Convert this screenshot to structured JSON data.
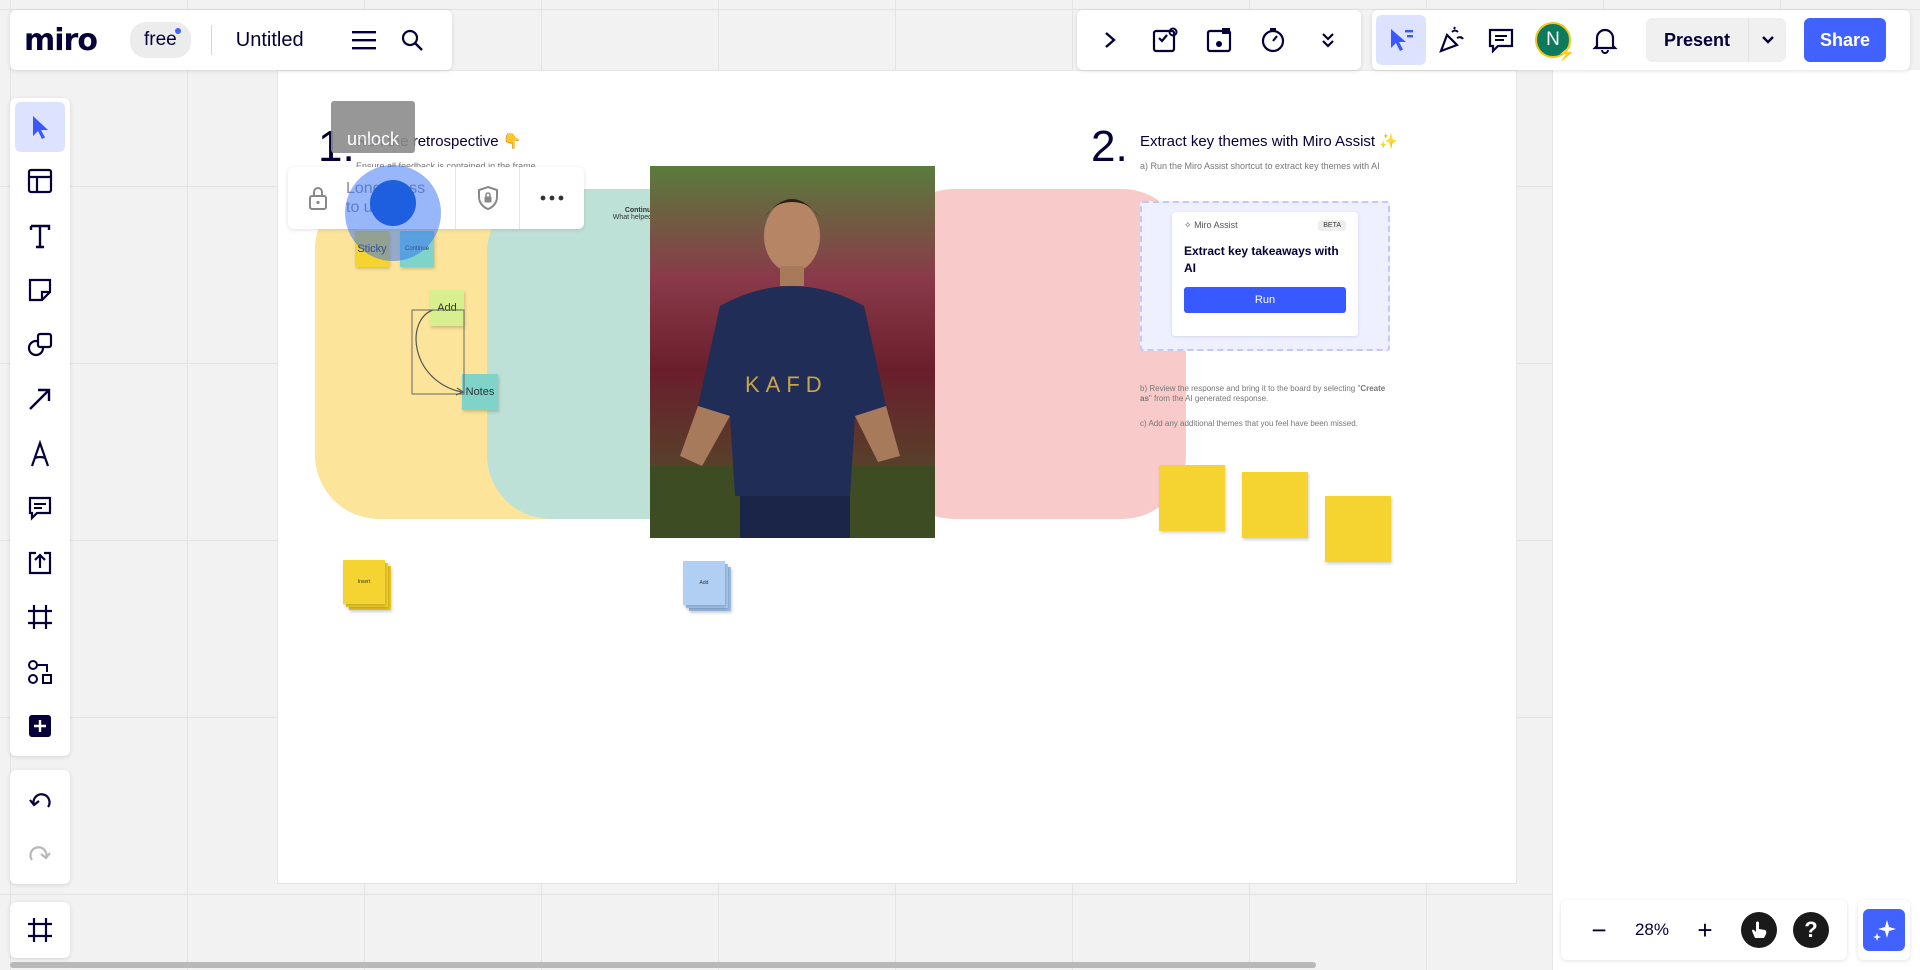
{
  "app": {
    "logo": "miro",
    "plan_badge": "free",
    "board_title": "Untitled"
  },
  "header": {
    "present_label": "Present",
    "share_label": "Share",
    "avatar_initial": "N"
  },
  "zoom": {
    "level": "28%",
    "minus": "−",
    "plus": "+",
    "help": "?"
  },
  "lock_popup": {
    "tooltip": "unlock",
    "hint_line1": "Long press",
    "hint_line2": "to unlock"
  },
  "board": {
    "step1": {
      "number": "1.",
      "title": "Run the retrospective 👇",
      "subtitle": "Ensure all feedback is contained in the frame"
    },
    "teal_note": {
      "title": "Continue",
      "text": "What helped us..."
    },
    "stickies": {
      "sticky": "Sticky",
      "continue": "Continue",
      "add": "Add",
      "notes": "Notes",
      "stack_yellow": "Insert",
      "stack_blue": "Add"
    },
    "step2": {
      "number": "2.",
      "title": "Extract key themes with Miro Assist ✨",
      "subtitle": "a) Run the Miro Assist shortcut to extract key themes with AI"
    },
    "ai_card": {
      "label": "Miro Assist",
      "badge": "BETA",
      "title": "Extract key takeaways with AI",
      "run": "Run"
    },
    "review": {
      "b_prefix": "b) Review the response and bring it to the board by selecting \"",
      "b_bold": "Create as",
      "b_suffix": "\" from the AI generated response.",
      "c": "c) Add any additional themes that you feel have been missed."
    }
  },
  "colors": {
    "accent": "#4262ff",
    "yellow_sticky": "#f5d431",
    "teal_sticky": "#7fd3c9",
    "blob_yellow": "#fce59a",
    "blob_teal": "#bde1d6",
    "blob_pink": "#f9caca"
  }
}
